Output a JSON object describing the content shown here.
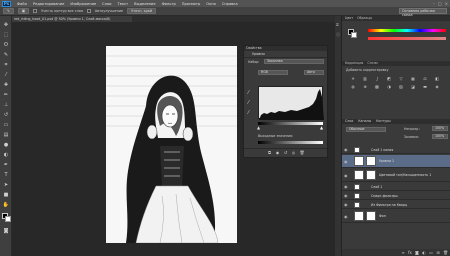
{
  "app": {
    "logo": "Ps"
  },
  "menu": [
    "Файл",
    "Редактирование",
    "Изображение",
    "Слои",
    "Текст",
    "Выделение",
    "Фильтр",
    "Просмотр",
    "Окно",
    "Справка"
  ],
  "window_controls": [
    "–",
    "□",
    "×"
  ],
  "options_bar": {
    "sample_all_layers": "Учесть контур все слоя",
    "auto_enhance": "Автоулучшение",
    "refine_edge": "Уточн. край",
    "workspace": "Основная рабочая среда"
  },
  "document_tab": "red_riding_hood_01.psd @ 50% (Уровни 1, Слой-маска/8)",
  "properties": {
    "tabs": "Свойства",
    "title": "Уровни",
    "preset_label": "Набор:",
    "preset_value": "Заказная",
    "channel_value": "RGB",
    "auto_label": "Авто",
    "output_label": "Выходные значения:"
  },
  "right_panel": {
    "color_tabs": [
      "Цвет",
      "Образцы"
    ],
    "adjust_tabs": [
      "Коррекция",
      "Стили"
    ],
    "adjust_hint": "Добавить корректировку",
    "layers_tabs": [
      "Слои",
      "Каналы",
      "Контуры"
    ],
    "blend_mode": "Обычные",
    "opacity_label": "Непрозр.:",
    "opacity_value": "100%",
    "fill_label": "Заливка:",
    "fill_value": "100%",
    "layers": [
      {
        "name": "Слой 1 копия",
        "selected": false,
        "big": false
      },
      {
        "name": "Уровни 1",
        "selected": true,
        "big": true
      },
      {
        "name": "Цветовой тон/Насыщенность 1",
        "selected": false,
        "big": true
      },
      {
        "name": "Слой 1",
        "selected": false,
        "big": false
      },
      {
        "name": "Смарт-фильтры",
        "selected": false,
        "big": false
      },
      {
        "name": "Из Фильтра на Кварц",
        "selected": false,
        "big": false
      },
      {
        "name": "Фон",
        "selected": false,
        "big": true
      }
    ]
  },
  "colors": {
    "accent": "#5a6c88",
    "panel": "#3a3a3a",
    "canvas_bg": "#282828"
  }
}
